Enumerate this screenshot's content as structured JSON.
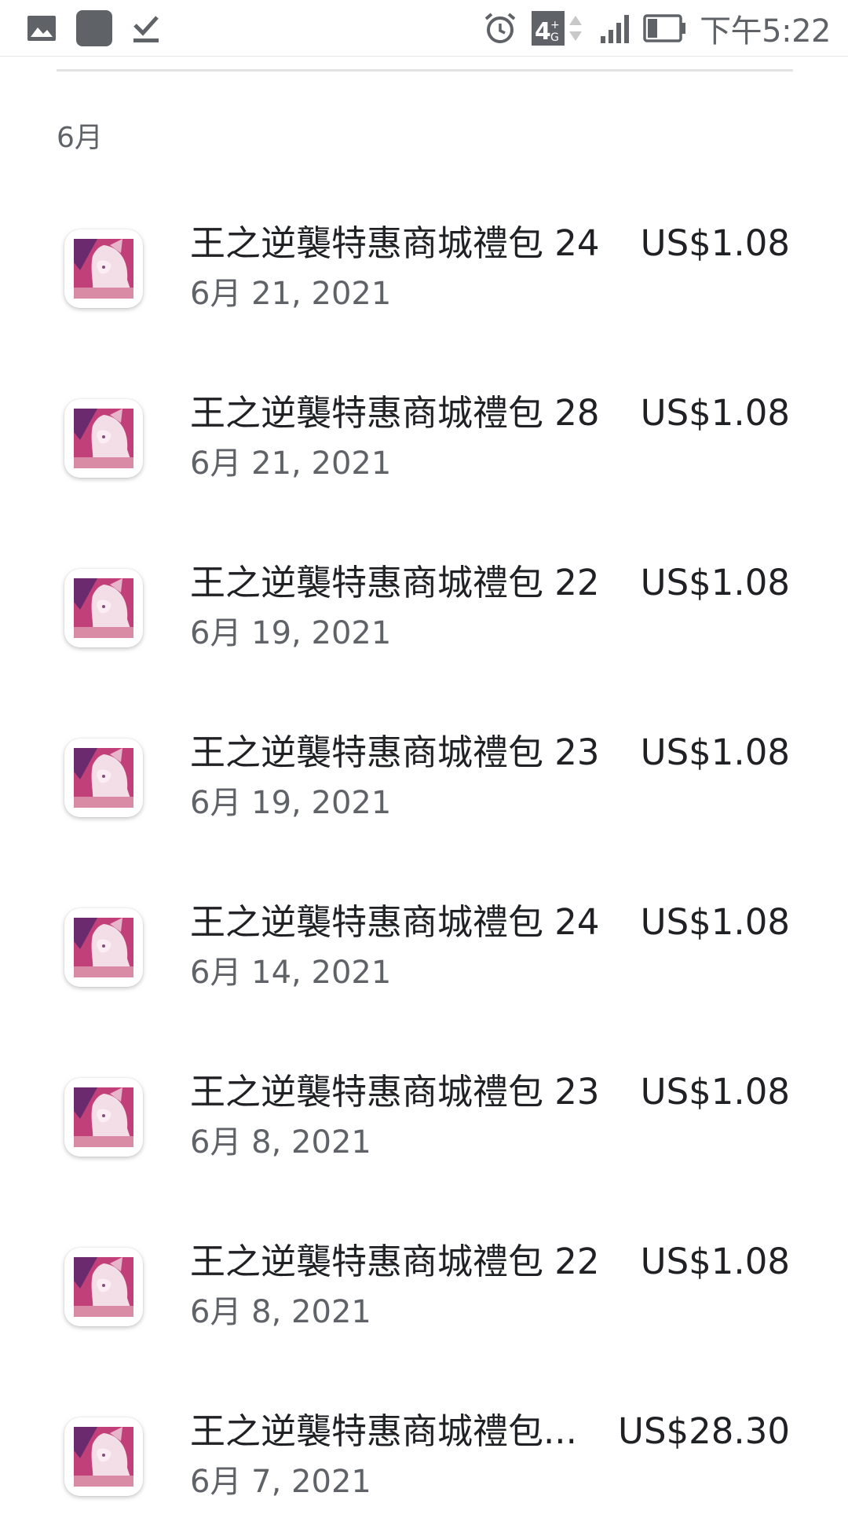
{
  "status_bar": {
    "time": "下午5:22",
    "network_label": "4G",
    "icons": [
      "image-icon",
      "app-square-icon",
      "download-done-icon",
      "alarm-icon",
      "network-4g-icon",
      "signal-icon",
      "battery-icon"
    ]
  },
  "section": {
    "month_label": "6月"
  },
  "purchases": [
    {
      "title": "王之逆襲特惠商城禮包 24",
      "date": "6月 21, 2021",
      "price": "US$1.08"
    },
    {
      "title": "王之逆襲特惠商城禮包 28",
      "date": "6月 21, 2021",
      "price": "US$1.08"
    },
    {
      "title": "王之逆襲特惠商城禮包 22",
      "date": "6月 19, 2021",
      "price": "US$1.08"
    },
    {
      "title": "王之逆襲特惠商城禮包 23",
      "date": "6月 19, 2021",
      "price": "US$1.08"
    },
    {
      "title": "王之逆襲特惠商城禮包 24",
      "date": "6月 14, 2021",
      "price": "US$1.08"
    },
    {
      "title": "王之逆襲特惠商城禮包 23",
      "date": "6月 8, 2021",
      "price": "US$1.08"
    },
    {
      "title": "王之逆襲特惠商城禮包 22",
      "date": "6月 8, 2021",
      "price": "US$1.08"
    },
    {
      "title": "王之逆襲特惠商城禮包...",
      "date": "6月 7, 2021",
      "price": "US$28.30"
    }
  ],
  "colors": {
    "primary_text": "#202124",
    "secondary_text": "#5f6368",
    "icon_pink": "#c2407a",
    "icon_purple": "#6b2a6e"
  }
}
